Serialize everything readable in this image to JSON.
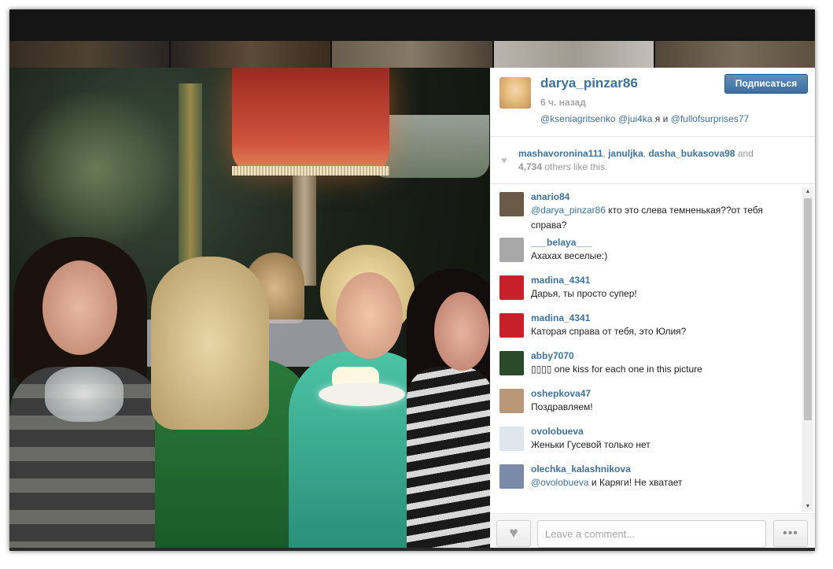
{
  "post": {
    "username": "darya_pinzar86",
    "time": "6 ч. назад",
    "caption": [
      {
        "text": "@kseniagritsenko",
        "mention": true
      },
      {
        "text": " ",
        "mention": false
      },
      {
        "text": "@jui4ka",
        "mention": true
      },
      {
        "text": " я и ",
        "mention": false
      },
      {
        "text": "@fullofsurprises77",
        "mention": true
      }
    ],
    "follow_label": "Подписаться"
  },
  "likes": {
    "users": [
      "mashavoronina111",
      "januljka",
      "dasha_bukasova98"
    ],
    "and": "and",
    "count": "4,734",
    "suffix": "others like this."
  },
  "comments": [
    {
      "user": "anario84",
      "avatar": "#6b5a48",
      "parts": [
        {
          "text": "@darya_pinzar86",
          "mention": true
        },
        {
          "text": " кто это слева темненькая??от тебя справа?",
          "mention": false
        }
      ]
    },
    {
      "user": "___belaya___",
      "avatar": "#a8a8a8",
      "parts": [
        {
          "text": "Ахахах веселые:)",
          "mention": false
        }
      ]
    },
    {
      "user": "madina_4341",
      "avatar": "#c8202a",
      "parts": [
        {
          "text": "Дарья, ты просто супер!",
          "mention": false
        }
      ]
    },
    {
      "user": "madina_4341",
      "avatar": "#c8202a",
      "parts": [
        {
          "text": "Каторая справа от тебя, это Юлия?",
          "mention": false
        }
      ]
    },
    {
      "user": "abby7070",
      "avatar": "#2a4a2a",
      "parts": [
        {
          "text": "▯▯▯▯ one kiss for each one in this picture",
          "mention": false
        }
      ]
    },
    {
      "user": "oshepkova47",
      "avatar": "#b89878",
      "parts": [
        {
          "text": "Поздравляем!",
          "mention": false
        }
      ]
    },
    {
      "user": "ovolobueva",
      "avatar": "#dfe6ee",
      "parts": [
        {
          "text": "Женьки Гусевой только нет",
          "mention": false
        }
      ]
    },
    {
      "user": "olechka_kalashnikova",
      "avatar": "#7a8aa8",
      "parts": [
        {
          "text": "@ovolobueva",
          "mention": true
        },
        {
          "text": " и Каряги! Не хватает",
          "mention": false
        }
      ]
    }
  ],
  "footer": {
    "comment_placeholder": "Leave a comment...",
    "like_icon": "heart-icon",
    "more_label": "•••"
  },
  "colors": {
    "accent": "#3f729b",
    "button": "#4a7aa8"
  }
}
